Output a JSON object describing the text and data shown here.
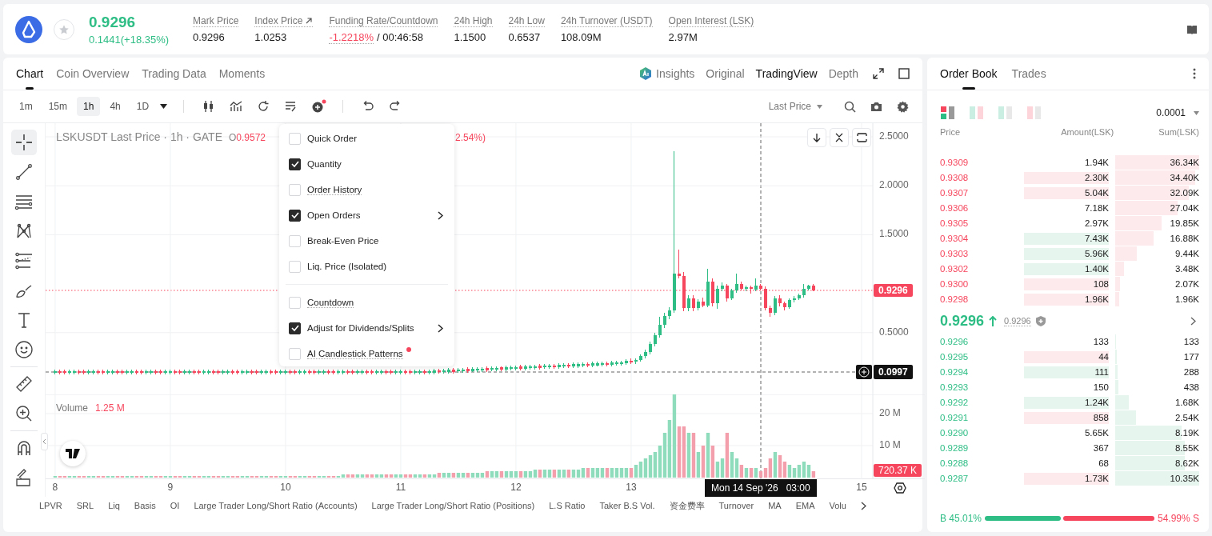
{
  "ticker": {
    "last_price": "0.9296",
    "change": "0.1441(+18.35%)",
    "favorite": false
  },
  "stats": [
    {
      "label": "Mark Price",
      "value": "0.9296",
      "link": false,
      "negative": false
    },
    {
      "label": "Index Price",
      "value": "1.0253",
      "link": true,
      "negative": false
    },
    {
      "label": "Funding Rate/Countdown",
      "value": "-1.2218%",
      "suffix": "/ 00:46:58",
      "link": false,
      "negative": true
    },
    {
      "label": "24h High",
      "value": "1.1500",
      "link": false,
      "negative": false
    },
    {
      "label": "24h Low",
      "value": "0.6537",
      "link": false,
      "negative": false
    },
    {
      "label": "24h Turnover (USDT)",
      "value": "108.09M",
      "link": false,
      "negative": false
    },
    {
      "label": "Open Interest (LSK)",
      "value": "2.97M",
      "link": false,
      "negative": false
    }
  ],
  "chart_tabs": [
    {
      "label": "Chart",
      "selected": true
    },
    {
      "label": "Coin Overview",
      "selected": false
    },
    {
      "label": "Trading Data",
      "selected": false
    },
    {
      "label": "Moments",
      "selected": false
    }
  ],
  "view_tabs": [
    {
      "label": "Insights",
      "selected": false,
      "kind": "ai"
    },
    {
      "label": "Original",
      "selected": false,
      "kind": "plain"
    },
    {
      "label": "TradingView",
      "selected": true,
      "kind": "plain"
    },
    {
      "label": "Depth",
      "selected": false,
      "kind": "plain"
    }
  ],
  "intervals": [
    {
      "label": "1m",
      "selected": false
    },
    {
      "label": "15m",
      "selected": false
    },
    {
      "label": "1h",
      "selected": true
    },
    {
      "label": "4h",
      "selected": false
    }
  ],
  "interval_dropdown": "1D",
  "price_type": "Last Price",
  "legend": {
    "symbol": "LSKUSDT Last Price · 1h · GATE",
    "open_label": "O",
    "open": "0.9572",
    "change_tail": "2.54%)"
  },
  "menu": {
    "sections": [
      {
        "items": [
          {
            "label": "Quick Order",
            "checked": false,
            "submenu": false,
            "info": false,
            "new": false
          },
          {
            "label": "Quantity",
            "checked": true,
            "submenu": false,
            "info": false,
            "new": false
          },
          {
            "label": "Order History",
            "checked": false,
            "submenu": false,
            "info": true,
            "new": false
          },
          {
            "label": "Open Orders",
            "checked": true,
            "submenu": true,
            "info": false,
            "new": false
          },
          {
            "label": "Break-Even Price",
            "checked": false,
            "submenu": false,
            "info": false,
            "new": false
          },
          {
            "label": "Liq. Price (Isolated)",
            "checked": false,
            "submenu": false,
            "info": false,
            "new": false
          }
        ]
      },
      {
        "items": [
          {
            "label": "Countdown",
            "checked": false,
            "submenu": false,
            "info": true,
            "new": false
          },
          {
            "label": "Adjust for Dividends/Splits",
            "checked": true,
            "submenu": true,
            "info": false,
            "new": false
          },
          {
            "label": "AI Candlestick Patterns",
            "checked": false,
            "submenu": false,
            "info": true,
            "new": true
          }
        ]
      }
    ]
  },
  "price_chart": {
    "chart_data": {
      "type": "candlestick",
      "grid": true,
      "ylim": [
        -0.131,
        2.639
      ],
      "xlim": [
        7.917,
        15.549
      ],
      "yticks": [
        {
          "value": 2.5,
          "label": "2.5000"
        },
        {
          "value": 2.0,
          "label": "2.0000"
        },
        {
          "value": 1.5,
          "label": "1.5000"
        },
        {
          "value": 0.5,
          "label": "0.5000"
        }
      ],
      "x": [
        8,
        8.042,
        8.083,
        8.125,
        8.167,
        8.208,
        8.25,
        8.292,
        8.333,
        8.375,
        8.417,
        8.458,
        8.5,
        8.542,
        8.583,
        8.625,
        8.667,
        8.708,
        8.75,
        8.792,
        8.833,
        8.875,
        8.917,
        8.958,
        9,
        9.042,
        9.083,
        9.125,
        9.167,
        9.208,
        9.25,
        9.292,
        9.333,
        9.375,
        9.417,
        9.458,
        9.5,
        9.542,
        9.583,
        9.625,
        9.667,
        9.708,
        9.75,
        9.792,
        9.833,
        9.875,
        9.917,
        9.958,
        10,
        10.042,
        10.083,
        10.125,
        10.167,
        10.208,
        10.25,
        10.292,
        10.333,
        10.375,
        10.417,
        10.458,
        10.5,
        10.542,
        10.583,
        10.625,
        10.667,
        10.708,
        10.75,
        10.792,
        10.833,
        10.875,
        10.917,
        10.958,
        11,
        11.042,
        11.083,
        11.125,
        11.167,
        11.208,
        11.25,
        11.292,
        11.333,
        11.375,
        11.417,
        11.458,
        11.5,
        11.542,
        11.583,
        11.625,
        11.667,
        11.708,
        11.75,
        11.792,
        11.833,
        11.875,
        11.917,
        11.958,
        12,
        12.042,
        12.083,
        12.125,
        12.167,
        12.208,
        12.25,
        12.292,
        12.333,
        12.375,
        12.417,
        12.458,
        12.5,
        12.542,
        12.583,
        12.625,
        12.667,
        12.708,
        12.75,
        12.792,
        12.833,
        12.875,
        12.917,
        12.958,
        13,
        13.042,
        13.083,
        13.125,
        13.167,
        13.208,
        13.25,
        13.292,
        13.333,
        13.375,
        13.417,
        13.458,
        13.5,
        13.542,
        13.583,
        13.625,
        13.667,
        13.708,
        13.75,
        13.792,
        13.833,
        13.875,
        13.917,
        13.958,
        14,
        14.042,
        14.083,
        14.125,
        14.167,
        14.208,
        14.25,
        14.292,
        14.333,
        14.375,
        14.417,
        14.458,
        14.5,
        14.542,
        14.583
      ],
      "ohlc": [
        [
          0.09,
          0.126,
          0.074,
          0.11
        ],
        [
          0.11,
          0.126,
          0.074,
          0.09
        ],
        [
          0.11,
          0.126,
          0.074,
          0.09
        ],
        [
          0.09,
          0.126,
          0.074,
          0.11
        ],
        [
          0.09,
          0.126,
          0.074,
          0.11
        ],
        [
          0.11,
          0.126,
          0.074,
          0.09
        ],
        [
          0.11,
          0.126,
          0.074,
          0.09
        ],
        [
          0.09,
          0.126,
          0.074,
          0.11
        ],
        [
          0.09,
          0.126,
          0.074,
          0.11
        ],
        [
          0.11,
          0.126,
          0.074,
          0.09
        ],
        [
          0.11,
          0.126,
          0.074,
          0.09
        ],
        [
          0.09,
          0.126,
          0.074,
          0.11
        ],
        [
          0.09,
          0.126,
          0.074,
          0.11
        ],
        [
          0.11,
          0.126,
          0.074,
          0.09
        ],
        [
          0.11,
          0.126,
          0.074,
          0.09
        ],
        [
          0.09,
          0.126,
          0.074,
          0.11
        ],
        [
          0.09,
          0.126,
          0.074,
          0.11
        ],
        [
          0.11,
          0.126,
          0.074,
          0.09
        ],
        [
          0.11,
          0.126,
          0.074,
          0.09
        ],
        [
          0.09,
          0.126,
          0.074,
          0.11
        ],
        [
          0.09,
          0.126,
          0.074,
          0.11
        ],
        [
          0.11,
          0.126,
          0.074,
          0.09
        ],
        [
          0.11,
          0.126,
          0.074,
          0.09
        ],
        [
          0.09,
          0.126,
          0.074,
          0.11
        ],
        [
          0.09,
          0.126,
          0.074,
          0.11
        ],
        [
          0.11,
          0.126,
          0.074,
          0.09
        ],
        [
          0.11,
          0.126,
          0.074,
          0.09
        ],
        [
          0.09,
          0.126,
          0.074,
          0.11
        ],
        [
          0.09,
          0.126,
          0.074,
          0.11
        ],
        [
          0.11,
          0.126,
          0.074,
          0.09
        ],
        [
          0.11,
          0.126,
          0.074,
          0.09
        ],
        [
          0.09,
          0.126,
          0.074,
          0.11
        ],
        [
          0.09,
          0.126,
          0.074,
          0.11
        ],
        [
          0.11,
          0.126,
          0.074,
          0.09
        ],
        [
          0.11,
          0.126,
          0.074,
          0.09
        ],
        [
          0.09,
          0.126,
          0.074,
          0.11
        ],
        [
          0.09,
          0.126,
          0.074,
          0.11
        ],
        [
          0.11,
          0.126,
          0.074,
          0.09
        ],
        [
          0.11,
          0.126,
          0.074,
          0.09
        ],
        [
          0.09,
          0.126,
          0.074,
          0.11
        ],
        [
          0.09,
          0.126,
          0.074,
          0.11
        ],
        [
          0.11,
          0.126,
          0.074,
          0.09
        ],
        [
          0.11,
          0.126,
          0.074,
          0.09
        ],
        [
          0.09,
          0.126,
          0.074,
          0.11
        ],
        [
          0.09,
          0.126,
          0.074,
          0.11
        ],
        [
          0.11,
          0.126,
          0.074,
          0.09
        ],
        [
          0.11,
          0.126,
          0.074,
          0.09
        ],
        [
          0.09,
          0.126,
          0.074,
          0.11
        ],
        [
          0.09,
          0.126,
          0.074,
          0.11
        ],
        [
          0.11,
          0.126,
          0.074,
          0.09
        ],
        [
          0.11,
          0.126,
          0.074,
          0.09
        ],
        [
          0.09,
          0.126,
          0.074,
          0.11
        ],
        [
          0.09,
          0.126,
          0.074,
          0.11
        ],
        [
          0.11,
          0.126,
          0.074,
          0.09
        ],
        [
          0.11,
          0.126,
          0.074,
          0.09
        ],
        [
          0.09,
          0.126,
          0.074,
          0.11
        ],
        [
          0.09,
          0.126,
          0.074,
          0.11
        ],
        [
          0.11,
          0.126,
          0.074,
          0.09
        ],
        [
          0.11,
          0.126,
          0.074,
          0.09
        ],
        [
          0.09,
          0.126,
          0.074,
          0.11
        ],
        [
          0.09,
          0.126,
          0.074,
          0.11
        ],
        [
          0.11,
          0.126,
          0.074,
          0.09
        ],
        [
          0.11,
          0.126,
          0.074,
          0.09
        ],
        [
          0.09,
          0.126,
          0.074,
          0.11
        ],
        [
          0.09,
          0.126,
          0.074,
          0.11
        ],
        [
          0.11,
          0.126,
          0.074,
          0.09
        ],
        [
          0.11,
          0.126,
          0.074,
          0.09
        ],
        [
          0.09,
          0.126,
          0.074,
          0.11
        ],
        [
          0.09,
          0.126,
          0.074,
          0.11
        ],
        [
          0.11,
          0.126,
          0.074,
          0.09
        ],
        [
          0.11,
          0.126,
          0.074,
          0.09
        ],
        [
          0.09,
          0.126,
          0.074,
          0.11
        ],
        [
          0.09,
          0.126,
          0.074,
          0.11
        ],
        [
          0.11,
          0.126,
          0.074,
          0.09
        ],
        [
          0.11,
          0.126,
          0.074,
          0.09
        ],
        [
          0.09,
          0.126,
          0.074,
          0.11
        ],
        [
          0.09,
          0.126,
          0.074,
          0.11
        ],
        [
          0.11,
          0.126,
          0.074,
          0.09
        ],
        [
          0.09,
          0.126,
          0.074,
          0.11
        ],
        [
          0.092,
          0.128,
          0.076,
          0.112
        ],
        [
          0.114,
          0.13,
          0.078,
          0.094
        ],
        [
          0.097,
          0.133,
          0.081,
          0.117
        ],
        [
          0.099,
          0.135,
          0.083,
          0.119
        ],
        [
          0.121,
          0.137,
          0.085,
          0.101
        ],
        [
          0.103,
          0.139,
          0.087,
          0.123
        ],
        [
          0.105,
          0.141,
          0.089,
          0.125
        ],
        [
          0.128,
          0.144,
          0.092,
          0.108
        ],
        [
          0.11,
          0.146,
          0.094,
          0.13
        ],
        [
          0.112,
          0.148,
          0.096,
          0.132
        ],
        [
          0.114,
          0.15,
          0.098,
          0.134
        ],
        [
          0.136,
          0.152,
          0.1,
          0.116
        ],
        [
          0.119,
          0.155,
          0.103,
          0.139
        ],
        [
          0.121,
          0.157,
          0.105,
          0.141
        ],
        [
          0.143,
          0.159,
          0.107,
          0.123
        ],
        [
          0.125,
          0.161,
          0.109,
          0.145
        ],
        [
          0.127,
          0.163,
          0.111,
          0.147
        ],
        [
          0.13,
          0.166,
          0.114,
          0.15
        ],
        [
          0.152,
          0.168,
          0.116,
          0.132
        ],
        [
          0.134,
          0.17,
          0.118,
          0.154
        ],
        [
          0.136,
          0.172,
          0.12,
          0.156
        ],
        [
          0.138,
          0.174,
          0.122,
          0.158
        ],
        [
          0.161,
          0.177,
          0.125,
          0.141
        ],
        [
          0.143,
          0.179,
          0.127,
          0.163
        ],
        [
          0.145,
          0.181,
          0.129,
          0.165
        ],
        [
          0.167,
          0.183,
          0.131,
          0.147
        ],
        [
          0.149,
          0.185,
          0.133,
          0.169
        ],
        [
          0.152,
          0.188,
          0.136,
          0.172
        ],
        [
          0.174,
          0.19,
          0.138,
          0.154
        ],
        [
          0.156,
          0.192,
          0.14,
          0.176
        ],
        [
          0.158,
          0.194,
          0.142,
          0.178
        ],
        [
          0.16,
          0.196,
          0.144,
          0.18
        ],
        [
          0.183,
          0.199,
          0.147,
          0.163
        ],
        [
          0.165,
          0.201,
          0.149,
          0.185
        ],
        [
          0.167,
          0.203,
          0.151,
          0.187
        ],
        [
          0.169,
          0.205,
          0.153,
          0.189
        ],
        [
          0.191,
          0.207,
          0.155,
          0.171
        ],
        [
          0.174,
          0.21,
          0.158,
          0.194
        ],
        [
          0.176,
          0.212,
          0.16,
          0.196
        ],
        [
          0.178,
          0.214,
          0.162,
          0.198
        ],
        [
          0.19,
          0.23,
          0.17,
          0.21
        ],
        [
          0.215,
          0.235,
          0.18,
          0.195
        ],
        [
          0.2,
          0.24,
          0.18,
          0.22
        ],
        [
          0.22,
          0.28,
          0.2,
          0.26
        ],
        [
          0.26,
          0.33,
          0.24,
          0.3
        ],
        [
          0.3,
          0.41,
          0.28,
          0.38
        ],
        [
          0.38,
          0.5,
          0.36,
          0.47
        ],
        [
          0.47,
          0.66,
          0.45,
          0.58
        ],
        [
          0.58,
          0.7,
          0.55,
          0.67
        ],
        [
          0.67,
          0.76,
          0.64,
          0.73
        ],
        [
          0.73,
          2.35,
          0.7,
          1.1
        ],
        [
          1.1,
          1.35,
          1.05,
          1.08
        ],
        [
          1.08,
          1.12,
          0.72,
          0.75
        ],
        [
          0.75,
          0.88,
          0.72,
          0.85
        ],
        [
          0.85,
          0.88,
          0.72,
          0.75
        ],
        [
          0.75,
          0.84,
          0.73,
          0.82
        ],
        [
          0.82,
          0.86,
          0.76,
          0.78
        ],
        [
          0.78,
          1.15,
          0.76,
          1.02
        ],
        [
          1.02,
          1.05,
          0.77,
          0.8
        ],
        [
          0.8,
          0.98,
          0.74,
          0.95
        ],
        [
          0.95,
          1.01,
          0.92,
          0.98
        ],
        [
          0.98,
          1.0,
          0.82,
          0.85
        ],
        [
          0.85,
          0.95,
          0.83,
          0.93
        ],
        [
          0.93,
          1.1,
          0.91,
          1.0
        ],
        [
          1.0,
          1.02,
          0.93,
          0.95
        ],
        [
          0.945,
          0.98,
          0.92,
          0.965
        ],
        [
          0.965,
          0.98,
          0.9,
          0.945
        ],
        [
          0.94,
          1.05,
          0.92,
          0.98
        ],
        [
          0.98,
          1.0,
          0.93,
          0.95
        ],
        [
          0.95,
          0.97,
          0.73,
          0.75
        ],
        [
          0.75,
          0.78,
          0.66,
          0.7
        ],
        [
          0.7,
          0.87,
          0.68,
          0.85
        ],
        [
          0.85,
          0.88,
          0.77,
          0.8
        ],
        [
          0.8,
          0.82,
          0.73,
          0.76
        ],
        [
          0.76,
          0.85,
          0.74,
          0.83
        ],
        [
          0.83,
          0.87,
          0.81,
          0.85
        ],
        [
          0.85,
          0.9,
          0.83,
          0.88
        ],
        [
          0.88,
          1.0,
          0.86,
          0.95
        ],
        [
          0.95,
          0.99,
          0.93,
          0.98
        ],
        [
          0.98,
          1.0,
          0.92,
          0.93
        ]
      ]
    }
  },
  "last_price_label": "0.9296",
  "crosshair_price": "0.0997",
  "crosshair_time": "Mon 14 Sep '26   03:00",
  "volume": {
    "label": "Volume",
    "value": "1.25 M",
    "last": "720.37 K",
    "chart_data": {
      "type": "bar",
      "grid": true,
      "ylim": [
        -0.5,
        26
      ],
      "xlim": [
        7.917,
        15.549
      ],
      "yticks": [
        {
          "value": 20,
          "label": "20 M"
        },
        {
          "value": 10,
          "label": "10 M"
        }
      ],
      "xticks": [
        {
          "value": 8,
          "label": "8"
        },
        {
          "value": 9,
          "label": "9"
        },
        {
          "value": 10,
          "label": "10"
        },
        {
          "value": 11,
          "label": "11"
        },
        {
          "value": 12,
          "label": "12"
        },
        {
          "value": 13,
          "label": "13"
        },
        {
          "value": 15,
          "label": "15"
        }
      ],
      "x": [
        8,
        8.042,
        8.083,
        8.125,
        8.167,
        8.208,
        8.25,
        8.292,
        8.333,
        8.375,
        8.417,
        8.458,
        8.5,
        8.542,
        8.583,
        8.625,
        8.667,
        8.708,
        8.75,
        8.792,
        8.833,
        8.875,
        8.917,
        8.958,
        9,
        9.042,
        9.083,
        9.125,
        9.167,
        9.208,
        9.25,
        9.292,
        9.333,
        9.375,
        9.417,
        9.458,
        9.5,
        9.542,
        9.583,
        9.625,
        9.667,
        9.708,
        9.75,
        9.792,
        9.833,
        9.875,
        9.917,
        9.958,
        10,
        10.042,
        10.083,
        10.125,
        10.167,
        10.208,
        10.25,
        10.292,
        10.333,
        10.375,
        10.417,
        10.458,
        10.5,
        10.542,
        10.583,
        10.625,
        10.667,
        10.708,
        10.75,
        10.792,
        10.833,
        10.875,
        10.917,
        10.958,
        11,
        11.042,
        11.083,
        11.125,
        11.167,
        11.208,
        11.25,
        11.292,
        11.333,
        11.375,
        11.417,
        11.458,
        11.5,
        11.542,
        11.583,
        11.625,
        11.667,
        11.708,
        11.75,
        11.792,
        11.833,
        11.875,
        11.917,
        11.958,
        12,
        12.042,
        12.083,
        12.125,
        12.167,
        12.208,
        12.25,
        12.292,
        12.333,
        12.375,
        12.417,
        12.458,
        12.5,
        12.542,
        12.583,
        12.625,
        12.667,
        12.708,
        12.75,
        12.792,
        12.833,
        12.875,
        12.917,
        12.958,
        13,
        13.042,
        13.083,
        13.125,
        13.167,
        13.208,
        13.25,
        13.292,
        13.333,
        13.375,
        13.417,
        13.458,
        13.5,
        13.542,
        13.583,
        13.625,
        13.667,
        13.708,
        13.75,
        13.792,
        13.833,
        13.875,
        13.917,
        13.958,
        14,
        14.042,
        14.083,
        14.125,
        14.167,
        14.208,
        14.25,
        14.292,
        14.333,
        14.375,
        14.417,
        14.458,
        14.5,
        14.542,
        14.583
      ],
      "series": [
        {
          "color": "#8fdcbd",
          "values": [
            0.5,
            null,
            null,
            0.5,
            0.5,
            null,
            null,
            0.5,
            0.5,
            null,
            null,
            0.5,
            0.5,
            null,
            null,
            0.5,
            0.5,
            null,
            null,
            0.5,
            0.5,
            null,
            null,
            0.5,
            0.5,
            null,
            null,
            0.5,
            0.5,
            null,
            null,
            0.5,
            0.5,
            null,
            null,
            0.5,
            0.5,
            null,
            null,
            0.5,
            0.5,
            null,
            null,
            0.5,
            0.5,
            null,
            null,
            0.5,
            0.5,
            null,
            null,
            0.5,
            0.5,
            null,
            null,
            0.5,
            0.5,
            null,
            null,
            0.5,
            1,
            null,
            null,
            1,
            1,
            null,
            null,
            1,
            1,
            null,
            null,
            1,
            1,
            null,
            null,
            1,
            1,
            null,
            1,
            1,
            null,
            1.5,
            1.5,
            null,
            1.5,
            1.5,
            null,
            1.5,
            1.5,
            1.5,
            null,
            2,
            2,
            null,
            2,
            2,
            2,
            null,
            2,
            2,
            2.5,
            null,
            2.5,
            2.5,
            null,
            2.5,
            2.5,
            null,
            2.5,
            2.5,
            3,
            null,
            3,
            3,
            3,
            null,
            3,
            3,
            3,
            3,
            null,
            4,
            5,
            6,
            7,
            8,
            10,
            14,
            18,
            26,
            null,
            null,
            14,
            null,
            8,
            null,
            14,
            null,
            5,
            6,
            null,
            8,
            6,
            null,
            3,
            null,
            3,
            null,
            null,
            null,
            8,
            null,
            null,
            4,
            3,
            4,
            5,
            4,
            null
          ]
        },
        {
          "color": "#f4a0ac",
          "values": [
            null,
            0.5,
            0.5,
            null,
            null,
            0.5,
            0.5,
            null,
            null,
            0.5,
            0.5,
            null,
            null,
            0.5,
            0.5,
            null,
            null,
            0.5,
            0.5,
            null,
            null,
            0.5,
            0.5,
            null,
            null,
            0.5,
            0.5,
            null,
            null,
            0.5,
            0.5,
            null,
            null,
            0.5,
            0.5,
            null,
            null,
            0.5,
            0.5,
            null,
            null,
            0.5,
            0.5,
            null,
            null,
            0.5,
            0.5,
            null,
            null,
            0.5,
            0.5,
            null,
            null,
            0.5,
            0.5,
            null,
            null,
            0.5,
            0.5,
            null,
            null,
            1,
            1,
            null,
            null,
            1,
            1,
            null,
            null,
            1,
            1,
            null,
            null,
            1,
            1,
            null,
            null,
            1,
            null,
            null,
            1.5,
            null,
            null,
            1.5,
            null,
            null,
            1.5,
            null,
            null,
            null,
            2,
            null,
            null,
            2,
            null,
            null,
            null,
            2,
            null,
            null,
            null,
            2.5,
            null,
            null,
            2.5,
            null,
            null,
            2.5,
            null,
            null,
            null,
            3,
            null,
            null,
            null,
            3,
            null,
            null,
            null,
            null,
            3,
            null,
            null,
            null,
            null,
            null,
            null,
            null,
            null,
            null,
            16,
            16,
            null,
            14,
            null,
            10,
            null,
            10,
            null,
            null,
            14,
            null,
            null,
            4,
            null,
            3,
            null,
            2,
            3,
            6,
            null,
            7,
            5,
            null,
            null,
            null,
            null,
            null,
            2
          ]
        }
      ]
    }
  },
  "indicators": [
    "LPVR",
    "SRL",
    "Liq",
    "Basis",
    "OI",
    "Large Trader Long/Short Ratio (Accounts)",
    "Large Trader Long/Short Ratio (Positions)",
    "L.S Ratio",
    "Taker B.S Vol.",
    "资金费率",
    "Turnover",
    "MA",
    "EMA",
    "Volu"
  ],
  "order_book": {
    "tabs": [
      {
        "label": "Order Book",
        "selected": true
      },
      {
        "label": "Trades",
        "selected": false
      }
    ],
    "layouts": [
      {
        "kind": "both",
        "selected": true
      },
      {
        "kind": "mixed",
        "selected": false
      },
      {
        "kind": "bids",
        "selected": false
      },
      {
        "kind": "asks",
        "selected": false
      }
    ],
    "precision": "0.0001",
    "columns": [
      "Price",
      "Amount(LSK)",
      "Sum(LSK)"
    ],
    "asks": [
      {
        "price": "0.9309",
        "amount": "1.94K",
        "sum": "36.34K",
        "buy_flash": false,
        "sell_flash": false
      },
      {
        "price": "0.9308",
        "amount": "2.30K",
        "sum": "34.40K",
        "buy_flash": false,
        "sell_flash": true
      },
      {
        "price": "0.9307",
        "amount": "5.04K",
        "sum": "32.09K",
        "buy_flash": false,
        "sell_flash": true
      },
      {
        "price": "0.9306",
        "amount": "7.18K",
        "sum": "27.04K",
        "buy_flash": false,
        "sell_flash": false
      },
      {
        "price": "0.9305",
        "amount": "2.97K",
        "sum": "19.85K",
        "buy_flash": false,
        "sell_flash": false
      },
      {
        "price": "0.9304",
        "amount": "7.43K",
        "sum": "16.88K",
        "buy_flash": true,
        "sell_flash": false
      },
      {
        "price": "0.9303",
        "amount": "5.96K",
        "sum": "9.44K",
        "buy_flash": true,
        "sell_flash": false
      },
      {
        "price": "0.9302",
        "amount": "1.40K",
        "sum": "3.48K",
        "buy_flash": true,
        "sell_flash": false
      },
      {
        "price": "0.9300",
        "amount": "108",
        "sum": "2.07K",
        "buy_flash": false,
        "sell_flash": true
      },
      {
        "price": "0.9298",
        "amount": "1.96K",
        "sum": "1.96K",
        "buy_flash": false,
        "sell_flash": true
      }
    ],
    "mid": {
      "price": "0.9296",
      "mark": "0.9296"
    },
    "bids": [
      {
        "price": "0.9296",
        "amount": "133",
        "sum": "133",
        "buy_flash": false,
        "sell_flash": false
      },
      {
        "price": "0.9295",
        "amount": "44",
        "sum": "177",
        "buy_flash": false,
        "sell_flash": true
      },
      {
        "price": "0.9294",
        "amount": "111",
        "sum": "288",
        "buy_flash": true,
        "sell_flash": false
      },
      {
        "price": "0.9293",
        "amount": "150",
        "sum": "438",
        "buy_flash": false,
        "sell_flash": false
      },
      {
        "price": "0.9292",
        "amount": "1.24K",
        "sum": "1.68K",
        "buy_flash": true,
        "sell_flash": false
      },
      {
        "price": "0.9291",
        "amount": "858",
        "sum": "2.54K",
        "buy_flash": false,
        "sell_flash": true
      },
      {
        "price": "0.9290",
        "amount": "5.65K",
        "sum": "8.19K",
        "buy_flash": false,
        "sell_flash": false
      },
      {
        "price": "0.9289",
        "amount": "367",
        "sum": "8.55K",
        "buy_flash": false,
        "sell_flash": false
      },
      {
        "price": "0.9288",
        "amount": "68",
        "sum": "8.62K",
        "buy_flash": false,
        "sell_flash": false
      },
      {
        "price": "0.9287",
        "amount": "1.73K",
        "sum": "10.35K",
        "buy_flash": false,
        "sell_flash": true
      }
    ],
    "ratio": {
      "buy": "B 45.01%",
      "sell": "54.99% S",
      "level": 0.4501
    }
  }
}
